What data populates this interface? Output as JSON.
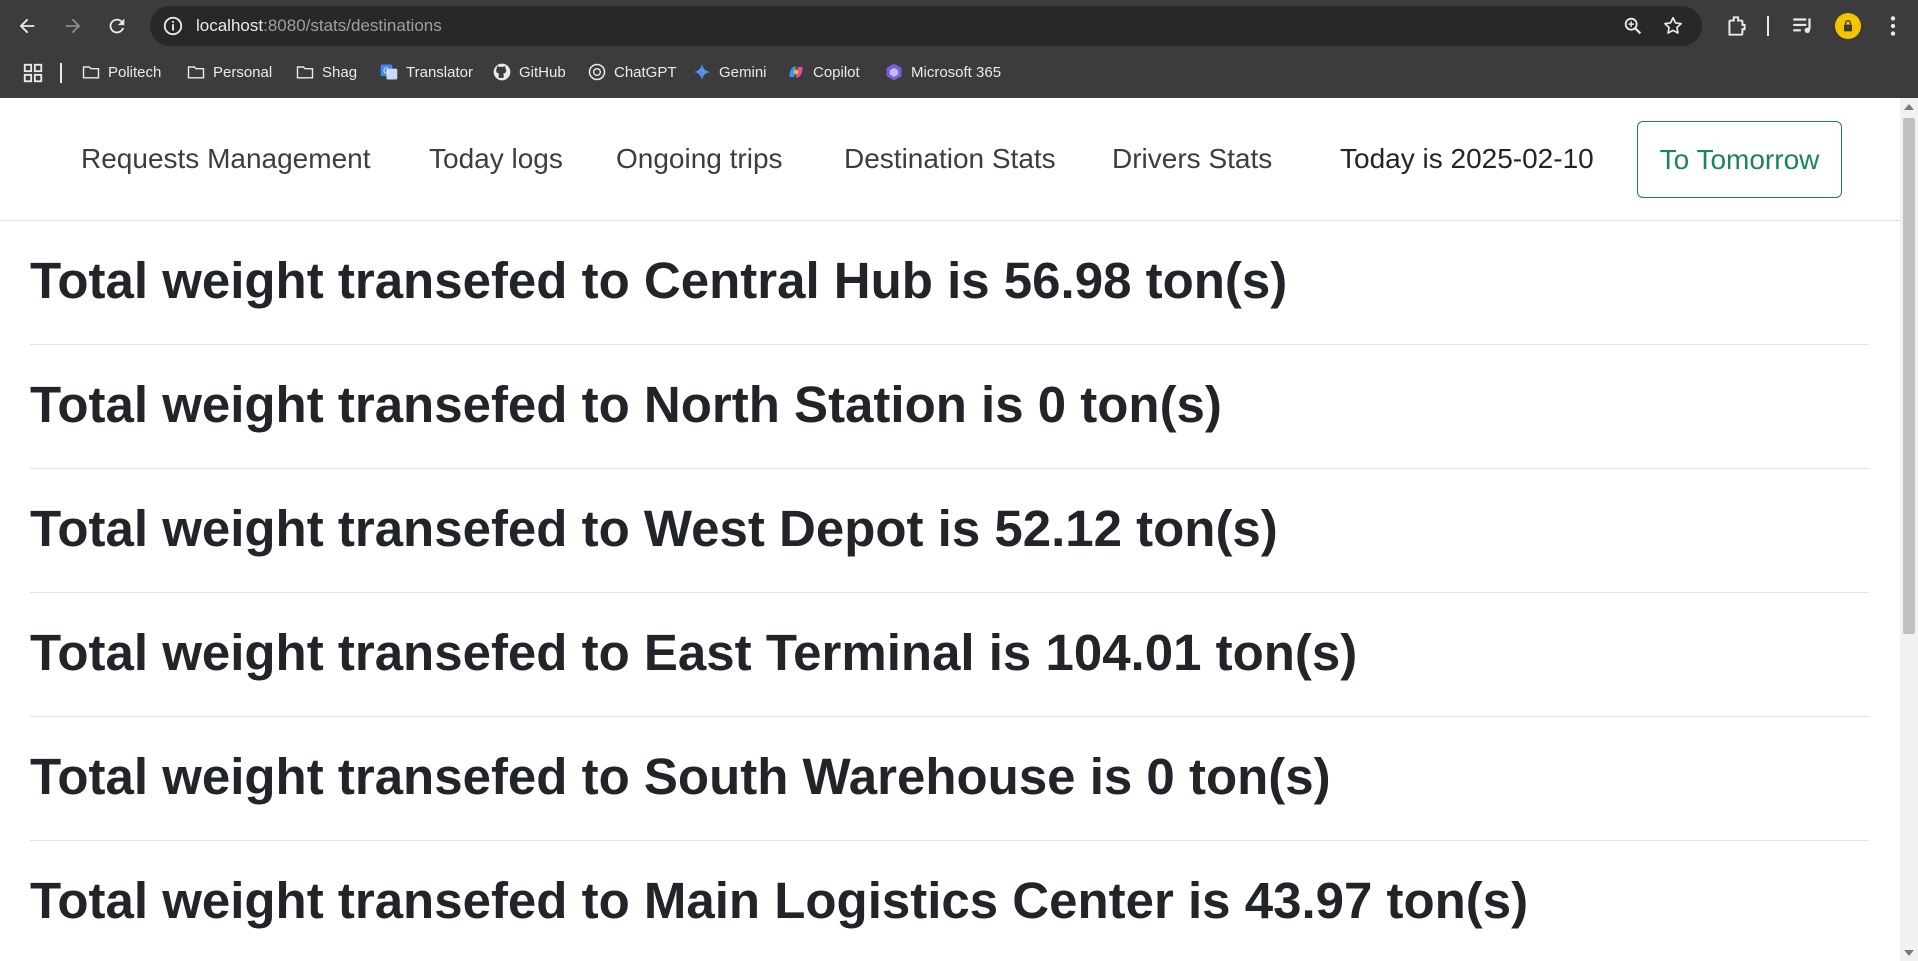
{
  "browser": {
    "url_host": "localhost",
    "url_path": ":8080/stats/destinations",
    "bookmarks": [
      {
        "label": "Politech",
        "icon": "folder-icon"
      },
      {
        "label": "Personal",
        "icon": "folder-icon"
      },
      {
        "label": "Shag",
        "icon": "folder-icon"
      },
      {
        "label": "Translator",
        "icon": "translator-icon"
      },
      {
        "label": "GitHub",
        "icon": "github-icon"
      },
      {
        "label": "ChatGPT",
        "icon": "chatgpt-icon"
      },
      {
        "label": "Gemini",
        "icon": "gemini-icon"
      },
      {
        "label": "Copilot",
        "icon": "copilot-icon"
      },
      {
        "label": "Microsoft 365",
        "icon": "microsoft365-icon"
      }
    ]
  },
  "navbar": {
    "links": [
      {
        "label": "Requests Management"
      },
      {
        "label": "Today logs"
      },
      {
        "label": "Ongoing trips"
      },
      {
        "label": "Destination Stats"
      },
      {
        "label": "Drivers Stats"
      }
    ],
    "today_text": "Today is 2025-02-10",
    "tomorrow_button": "To Tomorrow"
  },
  "stats": [
    {
      "text": "Total weight transefed to Central Hub is 56.98 ton(s)",
      "destination": "Central Hub",
      "weight": 56.98
    },
    {
      "text": "Total weight transefed to North Station is 0 ton(s)",
      "destination": "North Station",
      "weight": 0
    },
    {
      "text": "Total weight transefed to West Depot is 52.12 ton(s)",
      "destination": "West Depot",
      "weight": 52.12
    },
    {
      "text": "Total weight transefed to East Terminal is 104.01 ton(s)",
      "destination": "East Terminal",
      "weight": 104.01
    },
    {
      "text": "Total weight transefed to South Warehouse is 0 ton(s)",
      "destination": "South Warehouse",
      "weight": 0
    },
    {
      "text": "Total weight transefed to Main Logistics Center is 43.97 ton(s)",
      "destination": "Main Logistics Center",
      "weight": 43.97
    }
  ],
  "colors": {
    "button_accent": "#198754",
    "chrome_background": "#3c3c3c",
    "text": "#212529"
  }
}
